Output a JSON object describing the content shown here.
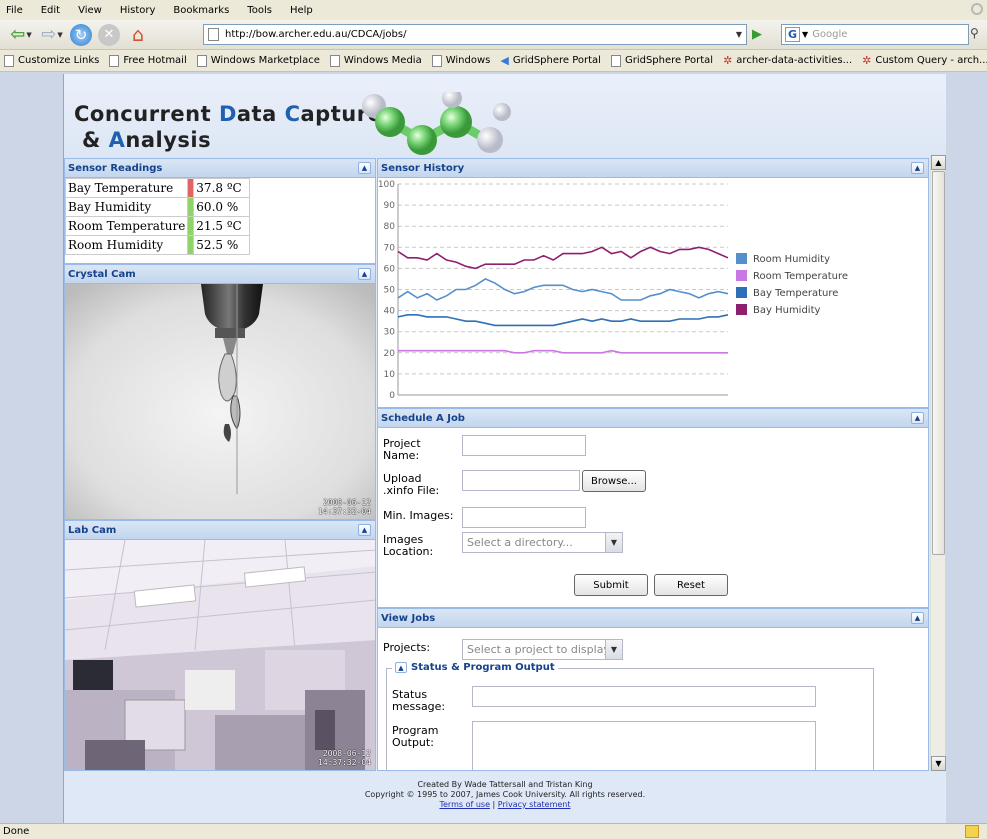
{
  "browser": {
    "menu": [
      "File",
      "Edit",
      "View",
      "History",
      "Bookmarks",
      "Tools",
      "Help"
    ],
    "url": "http://bow.archer.edu.au/CDCA/jobs/",
    "search_placeholder": "Google",
    "search_engine": "G",
    "bookmarks": [
      {
        "label": "Customize Links",
        "icon": "page-icon"
      },
      {
        "label": "Free Hotmail",
        "icon": "page-icon"
      },
      {
        "label": "Windows Marketplace",
        "icon": "page-icon"
      },
      {
        "label": "Windows Media",
        "icon": "page-icon"
      },
      {
        "label": "Windows",
        "icon": "page-icon"
      },
      {
        "label": "GridSphere Portal",
        "icon": "gridsphere-icon"
      },
      {
        "label": "GridSphere Portal",
        "icon": "page-icon"
      },
      {
        "label": "archer-data-activities...",
        "icon": "paw-icon"
      },
      {
        "label": "Custom Query - arch...",
        "icon": "paw-icon"
      }
    ],
    "status": "Done"
  },
  "banner": {
    "line1": [
      "Concurrent ",
      "D",
      "ata ",
      "C",
      "apture"
    ],
    "line2": [
      "& ",
      "A",
      "nalysis"
    ]
  },
  "sensor_readings": {
    "title": "Sensor Readings",
    "rows": [
      {
        "label": "Bay Temperature",
        "value": "37.8 ºC",
        "status_color": "#e06666"
      },
      {
        "label": "Bay Humidity",
        "value": "60.0 %",
        "status_color": "#8fd468"
      },
      {
        "label": "Room Temperature",
        "value": "21.5 ºC",
        "status_color": "#8fd468"
      },
      {
        "label": "Room Humidity",
        "value": "52.5 %",
        "status_color": "#8fd468"
      }
    ]
  },
  "crystal_cam": {
    "title": "Crystal Cam",
    "stamp_date": "2008-06-12",
    "stamp_time": "14:37:32-04"
  },
  "lab_cam": {
    "title": "Lab Cam",
    "stamp_date": "2008-06-12",
    "stamp_time": "14:37:32-04"
  },
  "sensor_history": {
    "title": "Sensor History"
  },
  "chart_data": {
    "type": "line",
    "title": "",
    "xlabel": "",
    "ylabel": "",
    "ylim": [
      0,
      100
    ],
    "yticks": [
      0,
      10,
      20,
      30,
      40,
      50,
      60,
      70,
      80,
      90,
      100
    ],
    "grid": "horizontal dashed",
    "legend_position": "right",
    "x": [
      1,
      2,
      3,
      4,
      5,
      6,
      7,
      8,
      9,
      10,
      11,
      12,
      13,
      14,
      15,
      16,
      17,
      18,
      19,
      20,
      21,
      22,
      23,
      24,
      25,
      26,
      27,
      28,
      29,
      30,
      31,
      32,
      33,
      34,
      35
    ],
    "series": [
      {
        "name": "Room Humidity",
        "color": "#5590cc",
        "values": [
          46,
          49,
          46,
          48,
          45,
          47,
          50,
          50,
          52,
          55,
          53,
          50,
          48,
          49,
          51,
          52,
          52,
          52,
          50,
          49,
          50,
          49,
          48,
          45,
          45,
          45,
          47,
          48,
          50,
          49,
          48,
          46,
          48,
          49,
          48
        ]
      },
      {
        "name": "Room Temperature",
        "color": "#c977e2",
        "values": [
          21,
          21,
          21,
          21,
          21,
          21,
          21,
          21,
          21,
          21,
          21,
          21,
          20,
          20,
          21,
          21,
          21,
          20,
          20,
          20,
          20,
          20,
          21,
          20,
          20,
          20,
          20,
          20,
          20,
          20,
          20,
          20,
          20,
          20,
          20
        ]
      },
      {
        "name": "Bay Temperature",
        "color": "#2e6fb8",
        "values": [
          37,
          38,
          38,
          37,
          37,
          37,
          36,
          35,
          35,
          34,
          33,
          33,
          33,
          33,
          33,
          33,
          33,
          34,
          35,
          36,
          35,
          36,
          35,
          35,
          36,
          35,
          35,
          35,
          35,
          36,
          36,
          36,
          37,
          37,
          38
        ]
      },
      {
        "name": "Bay Humidity",
        "color": "#8e1e6e",
        "values": [
          68,
          65,
          65,
          64,
          67,
          64,
          63,
          61,
          60,
          62,
          62,
          62,
          62,
          64,
          64,
          66,
          64,
          67,
          67,
          67,
          68,
          70,
          67,
          68,
          65,
          68,
          70,
          68,
          67,
          69,
          69,
          70,
          69,
          67,
          65
        ]
      }
    ]
  },
  "schedule_job": {
    "title": "Schedule A Job",
    "project_name_label": "Project Name:",
    "upload_label": "Upload .xinfo File:",
    "browse_label": "Browse...",
    "min_images_label": "Min. Images:",
    "images_location_label": "Images Location:",
    "images_location_placeholder": "Select a directory...",
    "submit_label": "Submit",
    "reset_label": "Reset"
  },
  "view_jobs": {
    "title": "View Jobs",
    "projects_label": "Projects:",
    "projects_placeholder": "Select a project to display",
    "fieldset_title": "Status & Program Output",
    "status_label": "Status message:",
    "output_label": "Program Output:"
  },
  "footer": {
    "line1": "Created By Wade Tattersall and Tristan King",
    "line2": "Copyright © 1995 to 2007, James Cook University. All rights reserved.",
    "terms": "Terms of use",
    "sep": "|",
    "privacy": "Privacy statement"
  }
}
